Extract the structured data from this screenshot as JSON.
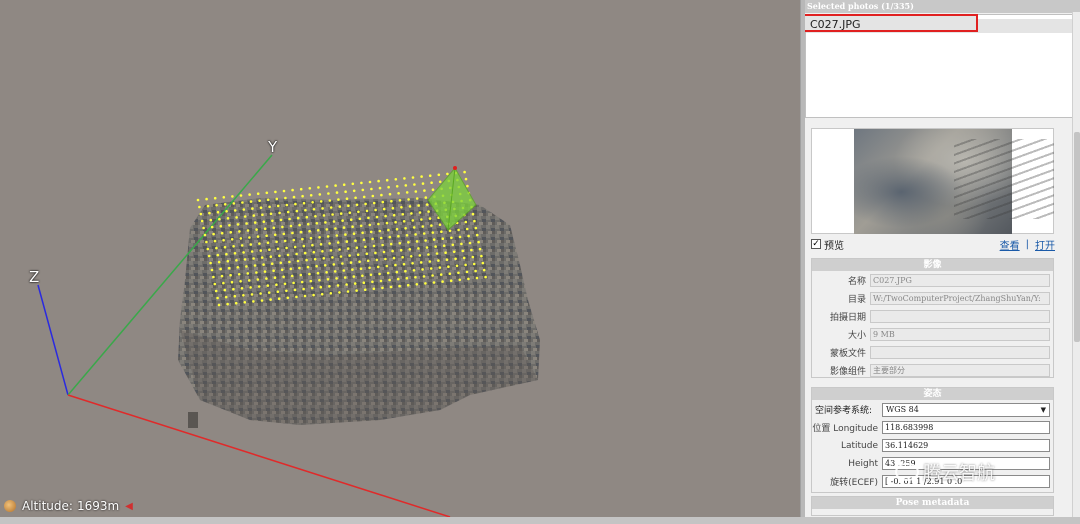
{
  "viewport": {
    "axis_labels": {
      "x": "",
      "y": "Y",
      "z": "Z"
    },
    "altitude_label": "Altitude:",
    "altitude_value": "1693m"
  },
  "panel": {
    "selected_header": "Selected photos (1/335)",
    "photos": [
      {
        "name": "C027.JPG"
      }
    ],
    "preview_checkbox_label": "预览",
    "preview_checked": true,
    "view_link": "查看",
    "open_link": "打开",
    "link_separator": "|",
    "image_section": {
      "title": "影像",
      "fields": [
        {
          "label": "名称",
          "value": "C027.JPG"
        },
        {
          "label": "目录",
          "value": "W:/TwoComputerProject/ZhangShuYan/Y:"
        },
        {
          "label": "拍摄日期",
          "value": ""
        },
        {
          "label": "大小",
          "value": "9 MB"
        },
        {
          "label": "蒙板文件",
          "value": ""
        },
        {
          "label": "影像组件",
          "value": "主要部分"
        }
      ]
    },
    "pose_section": {
      "title": "姿态",
      "srs_label": "空间参考系统:",
      "srs_value": "WGS 84",
      "fields": [
        {
          "label": "位置 Longitude",
          "value": "118.683998"
        },
        {
          "label": "Latitude",
          "value": "36.114629"
        },
        {
          "label": "Height",
          "value": "43 .259"
        },
        {
          "label": "旋转(ECEF)",
          "value": "[ -0. 01 1 /2.91 0 .0"
        }
      ]
    },
    "pose_metadata_title": "Pose metadata"
  },
  "watermark": {
    "text": "腾云智航"
  },
  "colors": {
    "viewport_bg": "#8f8883",
    "x_axis": "#e02a2a",
    "y_axis": "#3aa84a",
    "z_axis": "#2a2ae0",
    "tie_point": "#ffff40",
    "camera": "#7cd33a",
    "highlight": "#e02020"
  }
}
